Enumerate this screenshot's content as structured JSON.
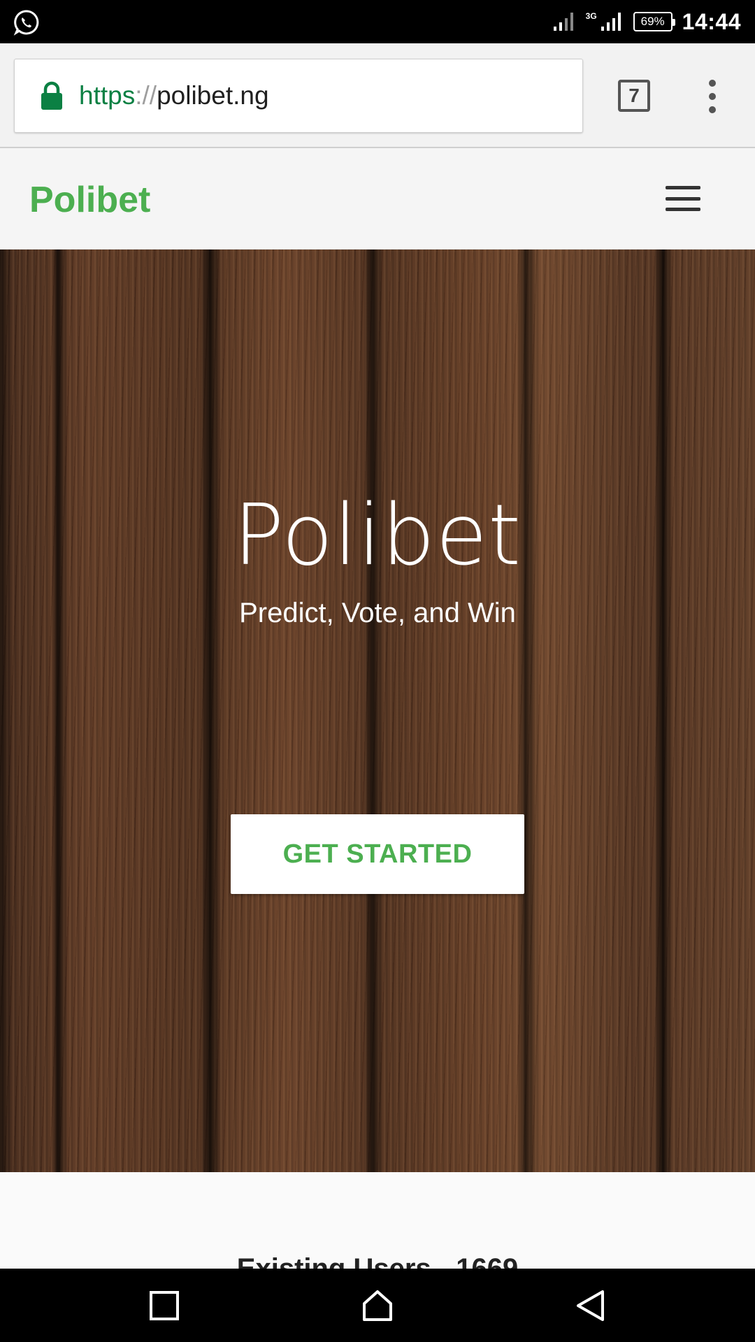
{
  "status_bar": {
    "network_label": "3G",
    "battery": "69%",
    "time": "14:44",
    "icons": [
      "whatsapp-icon",
      "signal-icon",
      "signal-3g-icon",
      "battery-icon"
    ]
  },
  "browser": {
    "url_scheme": "https",
    "url_separator": "://",
    "url_host": "polibet.ng",
    "tab_count": "7",
    "colors": {
      "scheme": "#0b8043",
      "lock": "#0b8043"
    }
  },
  "site": {
    "brand": "Polibet",
    "brand_color": "#4caf50"
  },
  "hero": {
    "title": "Polibet",
    "subtitle": "Predict, Vote, and Win",
    "cta_label": "GET STARTED"
  },
  "stats": {
    "existing_users": "Existing Users - 1669"
  }
}
